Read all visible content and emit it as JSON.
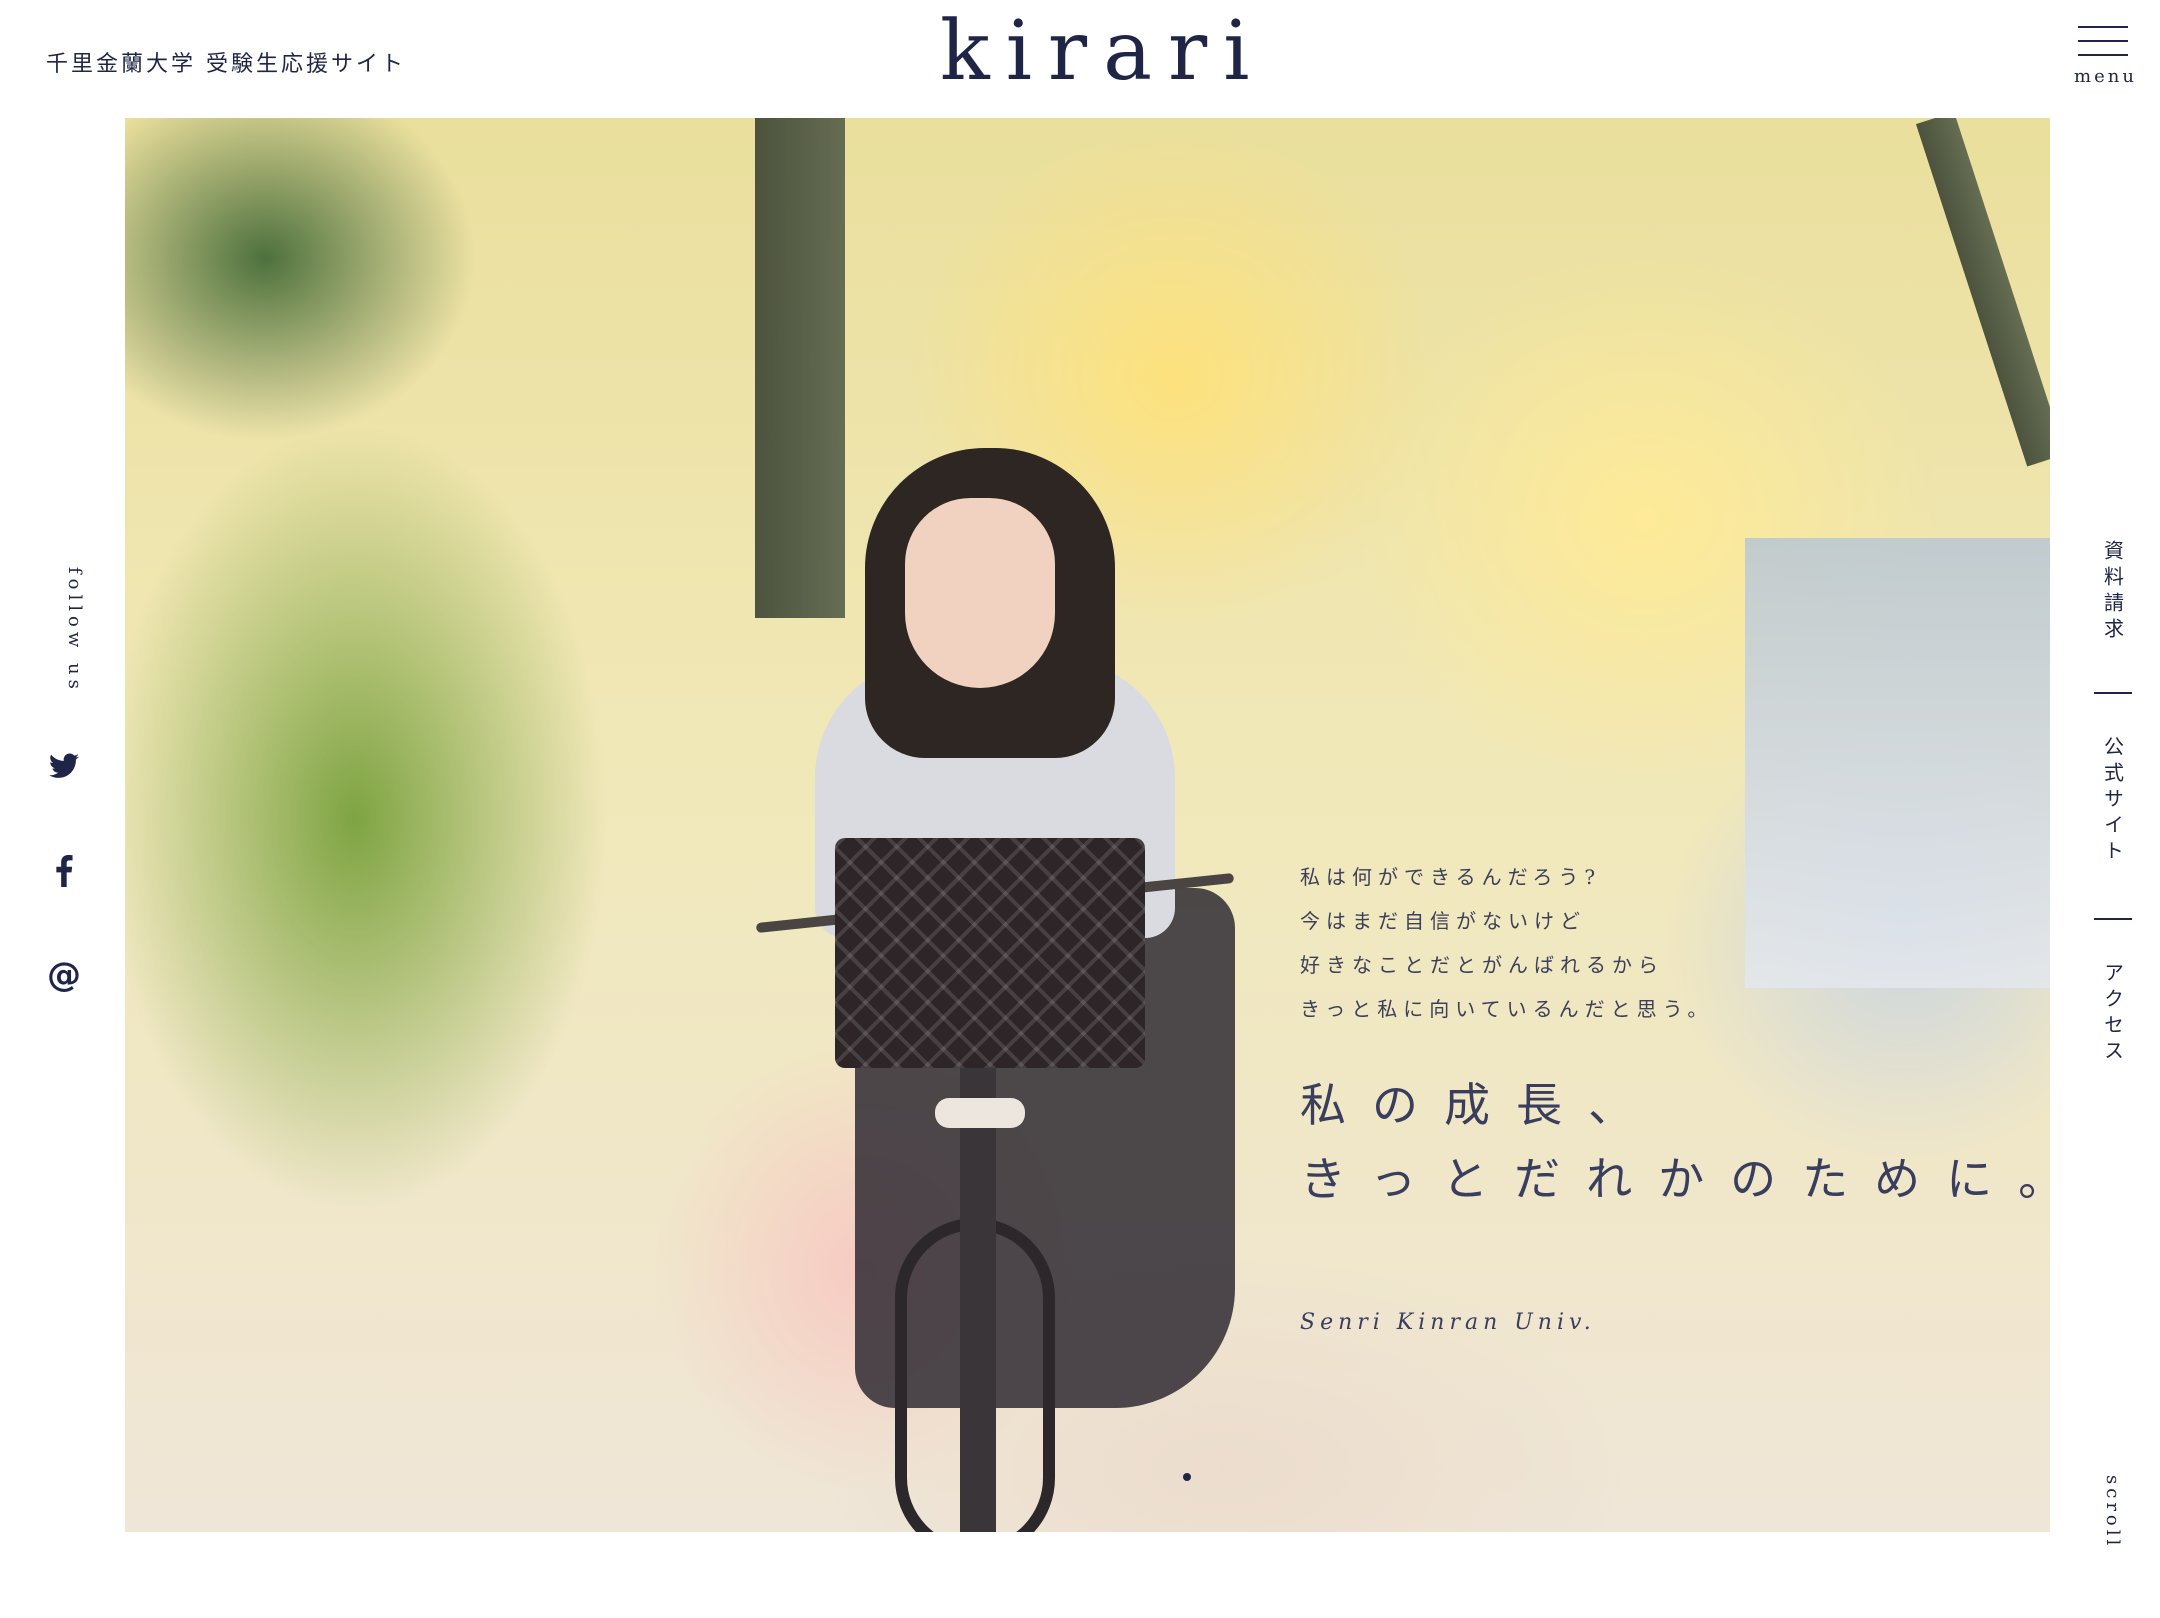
{
  "header": {
    "site_name": "千里金蘭大学 受験生応援サイト",
    "logo": "kirari",
    "menu_label": "menu"
  },
  "hero": {
    "sub_copy": [
      "私は何ができるんだろう?",
      "今はまだ自信がないけど",
      "好きなことだとがんばれるから",
      "きっと私に向いているんだと思う。"
    ],
    "main_copy": [
      "私の成長、",
      "きっとだれかのために。"
    ],
    "univ_name": "Senri Kinran Univ."
  },
  "social": {
    "label": "follow us",
    "items": [
      {
        "icon": "twitter-icon"
      },
      {
        "icon": "facebook-icon"
      },
      {
        "icon": "mail-icon",
        "glyph": "@"
      }
    ]
  },
  "side_nav": {
    "items": [
      "資料請求",
      "公式サイト",
      "アクセス"
    ]
  },
  "scroll_label": "scroll",
  "colors": {
    "primary": "#1f2547",
    "background": "#ffffff"
  }
}
